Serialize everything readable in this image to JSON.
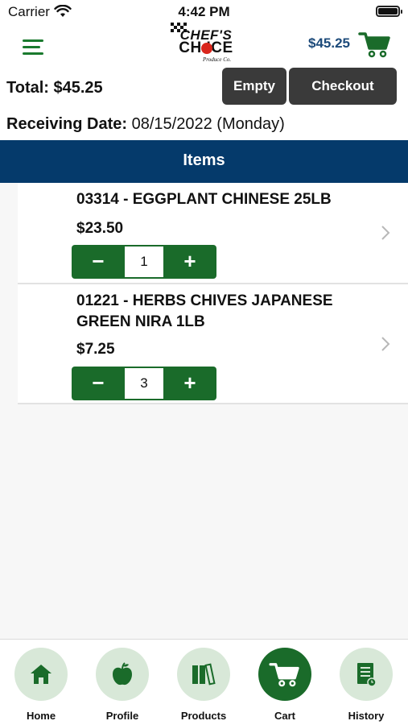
{
  "status_bar": {
    "carrier": "Carrier",
    "time": "4:42 PM"
  },
  "header": {
    "logo": {
      "line1": "CHEF'S",
      "line2": "CH  ICE",
      "line3": "Produce Co."
    },
    "cart_total": "$45.25"
  },
  "summary": {
    "total_label": "Total:  $45.25",
    "empty_label": "Empty",
    "checkout_label": "Checkout",
    "receiving_label": "Receiving Date:",
    "receiving_value": "08/15/2022 (Monday)"
  },
  "items_header": "Items",
  "items": [
    {
      "title": "03314 - EGGPLANT CHINESE 25LB",
      "price": "$23.50",
      "qty": "1",
      "minus": "−",
      "plus": "+"
    },
    {
      "title": "01221 - HERBS CHIVES JAPANESE GREEN NIRA 1LB",
      "price": "$7.25",
      "qty": "3",
      "minus": "−",
      "plus": "+"
    }
  ],
  "tabs": [
    {
      "label": "Home",
      "icon": "home-icon"
    },
    {
      "label": "Profile",
      "icon": "apple-icon"
    },
    {
      "label": "Products",
      "icon": "books-icon"
    },
    {
      "label": "Cart",
      "icon": "cart-icon",
      "active": true
    },
    {
      "label": "History",
      "icon": "receipt-icon"
    }
  ],
  "colors": {
    "green": "#1a6b2a",
    "navy": "#053a6b",
    "dark_button": "#3a3a3a",
    "price_blue": "#1c4a7a"
  }
}
